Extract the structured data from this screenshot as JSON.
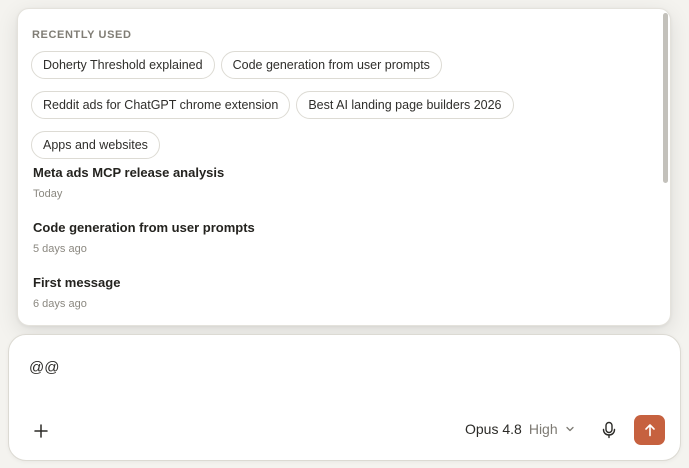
{
  "popup": {
    "section_title": "RECENTLY USED",
    "chips": [
      "Doherty Threshold explained",
      "Code generation from user prompts",
      "Reddit ads for ChatGPT chrome extension",
      "Best AI landing page builders 2026",
      "Apps and websites"
    ],
    "conversations": [
      {
        "title": "Meta ads MCP release analysis",
        "date": "Today"
      },
      {
        "title": "Code generation from user prompts",
        "date": "5 days ago"
      },
      {
        "title": "First message",
        "date": "6 days ago"
      }
    ]
  },
  "composer": {
    "text": "@@",
    "model_name": "Opus 4.8",
    "effort": "High"
  },
  "icons": {
    "plus": "plus-icon",
    "chevron": "chevron-down-icon",
    "mic": "microphone-icon",
    "send": "arrow-up-icon"
  },
  "colors": {
    "accent": "#c6613f",
    "background": "#f4f3ef"
  }
}
